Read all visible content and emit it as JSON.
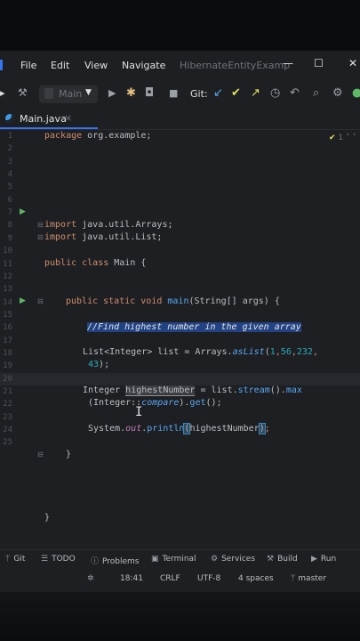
{
  "menu": {
    "items": [
      "File",
      "Edit",
      "View",
      "Navigate"
    ],
    "project_title": "HibernateEntityExamp"
  },
  "toolbar": {
    "config_label": "Main",
    "git_label": "Git:"
  },
  "tab": {
    "label": "Main.java",
    "close": "×"
  },
  "inspection": {
    "count": "1"
  },
  "code_lines": [
    {
      "n": "1"
    },
    {
      "n": "2"
    },
    {
      "n": "3"
    },
    {
      "n": "4"
    },
    {
      "n": "5"
    },
    {
      "n": "6"
    },
    {
      "n": "7"
    },
    {
      "n": "8"
    },
    {
      "n": "9"
    },
    {
      "n": "10"
    },
    {
      "n": "11"
    },
    {
      "n": "12"
    },
    {
      "n": "13"
    },
    {
      "n": "14"
    },
    {
      "n": "15"
    },
    {
      "n": "16"
    },
    {
      "n": "17"
    },
    {
      "n": "18"
    },
    {
      "n": "19"
    },
    {
      "n": "20"
    },
    {
      "n": "21"
    },
    {
      "n": "22"
    },
    {
      "n": "23"
    },
    {
      "n": "24"
    },
    {
      "n": "25"
    }
  ],
  "code": {
    "l1_kw": "package",
    "l1_rest": " org.example;",
    "l4_kw": "import",
    "l4_rest": " java.util.Arrays;",
    "l5_kw": "import",
    "l5_rest": " java.util.List;",
    "l7_kw": "public class",
    "l7_rest": " Main {",
    "l10_kw": "public static void",
    "l10_fn": " main",
    "l10_rest": "(String[] args) {",
    "l12_cmt": "//Find highest number in the given array",
    "l14_a": "List<Integer> list = Arrays.",
    "l14_fn": "asList",
    "l14_b": "(",
    "l14_n1": "1",
    "l14_c1": ",",
    "l14_n2": "56",
    "l14_c2": ",",
    "l14_n3": "232",
    "l14_c3": ",",
    "l15_n": "43",
    "l15_rest": ");",
    "l16_a": "Integer ",
    "l16_var": "highestNumber",
    "l16_b": " = list.",
    "l16_fn1": "stream",
    "l16_c": "().",
    "l16_fn2": "max",
    "l17_a": "(Integer::",
    "l17_fn": "compare",
    "l17_b": ").",
    "l17_fn2": "get",
    "l17_c": "();",
    "l18_a": "System.",
    "l18_out": "out",
    "l18_b": ".",
    "l18_fn": "println",
    "l18_p": "(",
    "l18_arg": "highestNumber",
    "l18_p2": ")",
    "l18_end": ";",
    "l20": "}",
    "l25": "}"
  },
  "toolwindows": [
    {
      "label": "Git",
      "icon": "git-branch-icon"
    },
    {
      "label": "TODO",
      "icon": "todo-list-icon"
    },
    {
      "label": "Problems",
      "icon": "problems-icon"
    },
    {
      "label": "Terminal",
      "icon": "terminal-icon"
    },
    {
      "label": "Services",
      "icon": "services-icon"
    },
    {
      "label": "Build",
      "icon": "hammer-icon"
    },
    {
      "label": "Run",
      "icon": "run-icon"
    }
  ],
  "status": {
    "position": "18:41",
    "line_sep": "CRLF",
    "encoding": "UTF-8",
    "indent": "4 spaces",
    "branch": "master"
  },
  "colors": {
    "background": "#1e1f22",
    "accent": "#3574f0",
    "keyword": "#cf8e6d",
    "function": "#56a8f5",
    "number": "#2aacb8",
    "run_green": "#5fb865"
  }
}
